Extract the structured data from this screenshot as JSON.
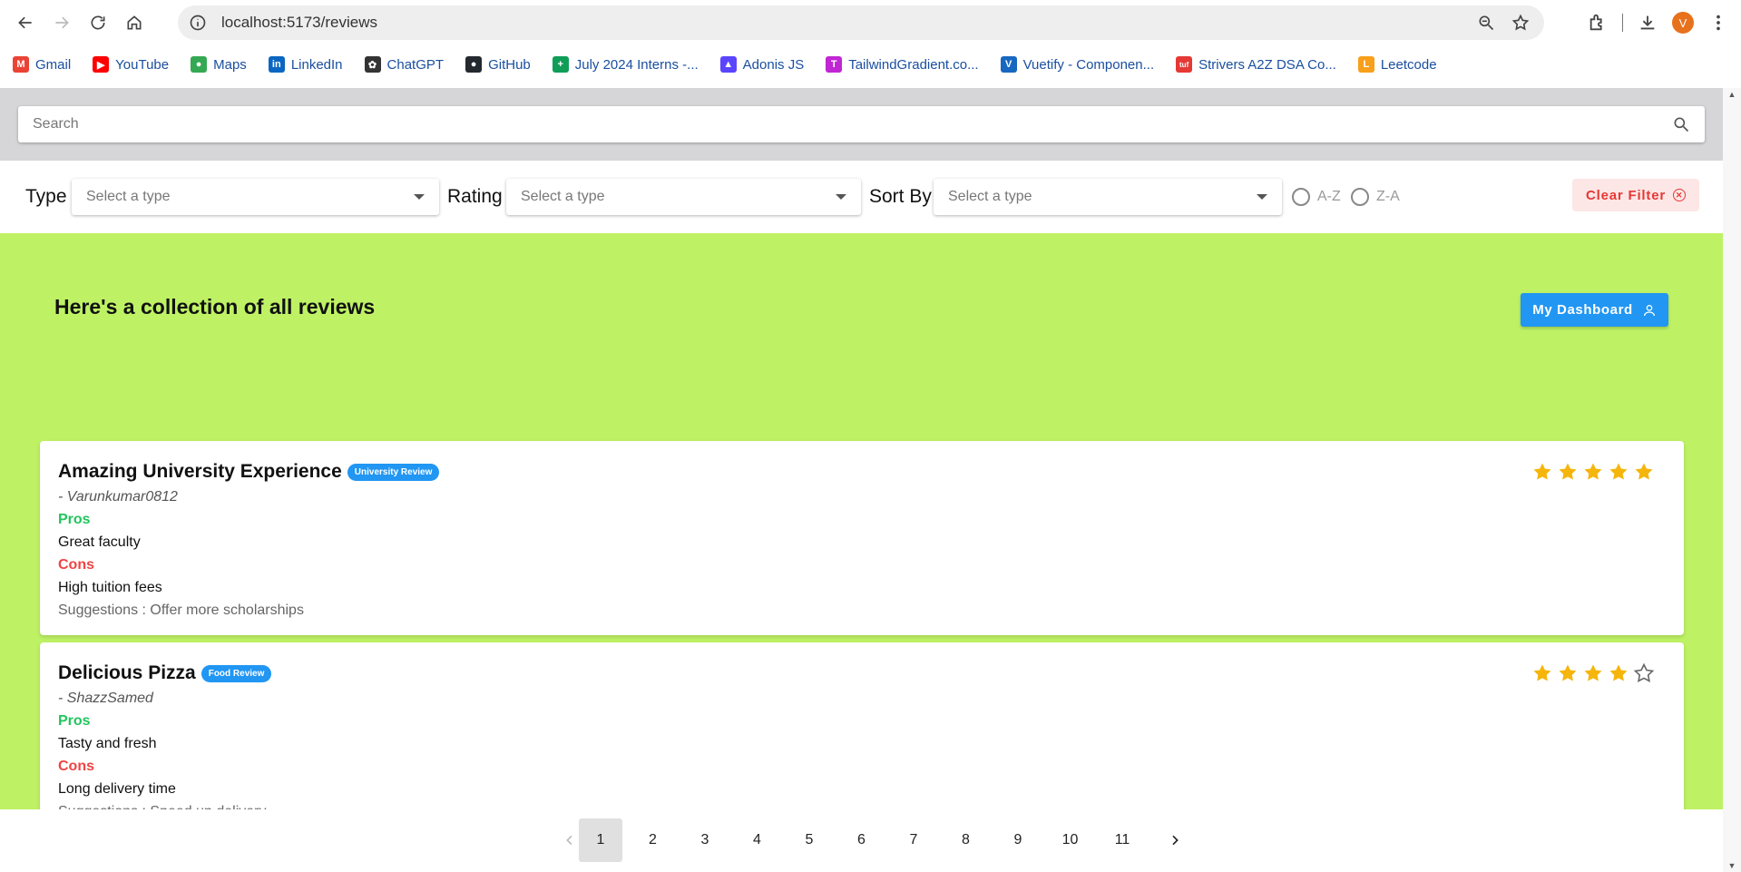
{
  "browser": {
    "url": "localhost:5173/reviews",
    "profile_initial": "V",
    "bookmarks": [
      {
        "label": "Gmail",
        "icon": "gmail-icon",
        "color": "#ea4335",
        "glyph": "M"
      },
      {
        "label": "YouTube",
        "icon": "youtube-icon",
        "color": "#ff0000",
        "glyph": "▶"
      },
      {
        "label": "Maps",
        "icon": "maps-icon",
        "color": "#34a853",
        "glyph": "●"
      },
      {
        "label": "LinkedIn",
        "icon": "linkedin-icon",
        "color": "#0a66c2",
        "glyph": "in"
      },
      {
        "label": "ChatGPT",
        "icon": "chatgpt-icon",
        "color": "#333333",
        "glyph": "✿"
      },
      {
        "label": "GitHub",
        "icon": "github-icon",
        "color": "#24292f",
        "glyph": "●"
      },
      {
        "label": "July 2024 Interns -...",
        "icon": "sheets-icon",
        "color": "#0f9d58",
        "glyph": "+"
      },
      {
        "label": "Adonis JS",
        "icon": "adonis-icon",
        "color": "#5a45ff",
        "glyph": "▲"
      },
      {
        "label": "TailwindGradient.co...",
        "icon": "tailwindgradient-icon",
        "color": "#c026d3",
        "glyph": "T"
      },
      {
        "label": "Vuetify - Componen...",
        "icon": "vuetify-icon",
        "color": "#1867c0",
        "glyph": "V"
      },
      {
        "label": "Strivers A2Z DSA Co...",
        "icon": "striver-icon",
        "color": "#e53935",
        "glyph": "tuf"
      },
      {
        "label": "Leetcode",
        "icon": "leetcode-icon",
        "color": "#f89f1b",
        "glyph": "L"
      }
    ]
  },
  "search": {
    "placeholder": "Search"
  },
  "filters": {
    "type_label": "Type",
    "type_placeholder": "Select a type",
    "rating_label": "Rating",
    "rating_placeholder": "Select a type",
    "sort_label": "Sort By",
    "sort_placeholder": "Select a type",
    "radio_az": "A-Z",
    "radio_za": "Z-A",
    "clear_label": "Clear Filter"
  },
  "main": {
    "heading": "Here's a collection of all reviews",
    "dashboard_label": "My Dashboard"
  },
  "reviews": [
    {
      "title": "Amazing University Experience",
      "badge": "University Review",
      "author": "- Varunkumar0812",
      "pros_label": "Pros",
      "pros": "Great faculty",
      "cons_label": "Cons",
      "cons": "High tuition fees",
      "suggestions": "Suggestions : Offer more scholarships",
      "rating": 5
    },
    {
      "title": "Delicious Pizza",
      "badge": "Food Review",
      "author": "- ShazzSamed",
      "pros_label": "Pros",
      "pros": "Tasty and fresh",
      "cons_label": "Cons",
      "cons": "Long delivery time",
      "suggestions": "Suggestions : Speed up delivery",
      "rating": 4
    }
  ],
  "pagination": {
    "pages": [
      "1",
      "2",
      "3",
      "4",
      "5",
      "6",
      "7",
      "8",
      "9",
      "10",
      "11"
    ],
    "current": "1"
  },
  "colors": {
    "accent": "#2196f3",
    "green_bg": "#bef264",
    "star": "#f5b50a",
    "pros": "#22c55e",
    "cons": "#ef4444"
  }
}
